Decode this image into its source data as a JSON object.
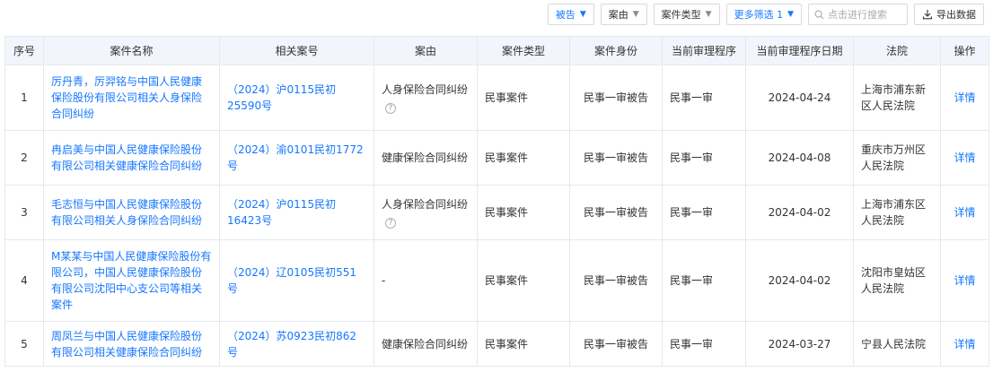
{
  "toolbar": {
    "filters": [
      {
        "label": "被告",
        "active": true
      },
      {
        "label": "案由",
        "active": false
      },
      {
        "label": "案件类型",
        "active": false
      },
      {
        "label": "更多筛选 1",
        "active": true
      }
    ],
    "search_placeholder": "点击进行搜索",
    "export_label": "导出数据"
  },
  "table": {
    "headers": [
      "序号",
      "案件名称",
      "相关案号",
      "案由",
      "案件类型",
      "案件身份",
      "当前审理程序",
      "当前审理程序日期",
      "法院",
      "操作"
    ],
    "rows": [
      {
        "index": "1",
        "name": "厉丹青，厉羿铭与中国人民健康保险股份有限公司相关人身保险合同纠纷",
        "case_no": "（2024）沪0115民初25590号",
        "cause": "人身保险合同纠纷",
        "has_help": true,
        "type": "民事案件",
        "role": "民事一审被告",
        "stage": "民事一审",
        "date": "2024-04-24",
        "court": "上海市浦东新区人民法院",
        "action": "详情"
      },
      {
        "index": "2",
        "name": "冉启美与中国人民健康保险股份有限公司相关健康保险合同纠纷",
        "case_no": "（2024）渝0101民初1772号",
        "cause": "健康保险合同纠纷",
        "has_help": false,
        "type": "民事案件",
        "role": "民事一审被告",
        "stage": "民事一审",
        "date": "2024-04-08",
        "court": "重庆市万州区人民法院",
        "action": "详情"
      },
      {
        "index": "3",
        "name": "毛志恒与中国人民健康保险股份有限公司相关人身保险合同纠纷",
        "case_no": "（2024）沪0115民初16423号",
        "cause": "人身保险合同纠纷",
        "has_help": true,
        "type": "民事案件",
        "role": "民事一审被告",
        "stage": "民事一审",
        "date": "2024-04-02",
        "court": "上海市浦东区人民法院",
        "action": "详情"
      },
      {
        "index": "4",
        "name": "M某某与中国人民健康保险股份有限公司，中国人民健康保险股份有限公司沈阳中心支公司等相关案件",
        "case_no": "（2024）辽0105民初551号",
        "cause": "-",
        "has_help": false,
        "type": "民事案件",
        "role": "民事一审被告",
        "stage": "民事一审",
        "date": "2024-04-02",
        "court": "沈阳市皇姑区人民法院",
        "action": "详情"
      },
      {
        "index": "5",
        "name": "周凤兰与中国人民健康保险股份有限公司相关健康保险合同纠纷",
        "case_no": "（2024）苏0923民初862号",
        "cause": "健康保险合同纠纷",
        "has_help": false,
        "type": "民事案件",
        "role": "民事一审被告",
        "stage": "民事一审",
        "date": "2024-03-27",
        "court": "宁县人民法院",
        "action": "详情"
      }
    ]
  },
  "colors": {
    "accent": "#1677ff",
    "header_bg": "#f2f6fc",
    "border": "#e4e9f0"
  }
}
